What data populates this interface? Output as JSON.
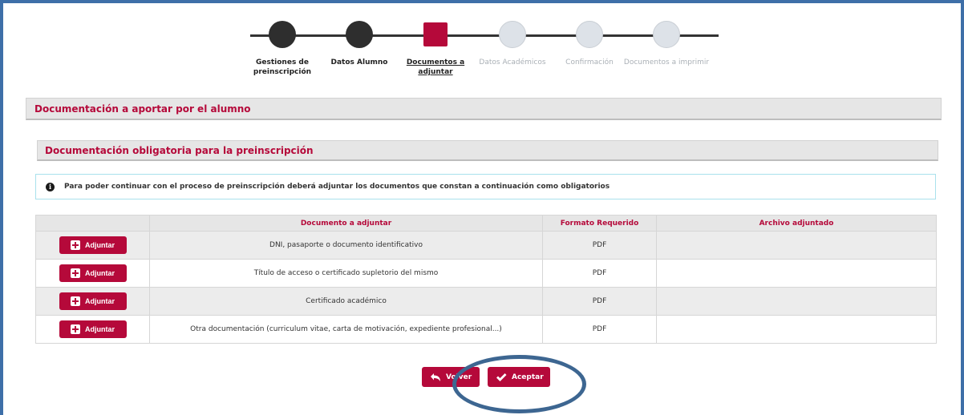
{
  "stepper": {
    "steps": [
      {
        "label": "Gestiones de preinscripción",
        "state": "done"
      },
      {
        "label": "Datos Alumno",
        "state": "done"
      },
      {
        "label": "Documentos a adjuntar",
        "state": "current"
      },
      {
        "label": "Datos Académicos",
        "state": "todo"
      },
      {
        "label": "Confirmación",
        "state": "todo"
      },
      {
        "label": "Documentos a imprimir",
        "state": "todo"
      }
    ]
  },
  "section": {
    "title": "Documentación a aportar por el alumno"
  },
  "subsection": {
    "title": "Documentación obligatoria para la preinscripción"
  },
  "alert": {
    "icon": "info-icon",
    "message": "Para poder continuar con el proceso de preinscripción deberá adjuntar los documentos que constan a continuación como obligatorios"
  },
  "table": {
    "headers": [
      "",
      "Documento a adjuntar",
      "Formato Requerido",
      "Archivo adjuntado"
    ],
    "attach_label": "Adjuntar",
    "rows": [
      {
        "document": "DNI, pasaporte o documento identificativo",
        "format": "PDF",
        "file": ""
      },
      {
        "document": "Título de acceso o certificado supletorio del mismo",
        "format": "PDF",
        "file": ""
      },
      {
        "document": "Certificado académico",
        "format": "PDF",
        "file": ""
      },
      {
        "document": "Otra documentación (curriculum vitae, carta de motivación, expediente profesional...)",
        "format": "PDF",
        "file": ""
      }
    ]
  },
  "actions": {
    "back_label": "Volver",
    "accept_label": "Aceptar"
  },
  "colors": {
    "accent": "#b5093a",
    "frame": "#3e6fa8",
    "annotation": "#3d6691"
  }
}
